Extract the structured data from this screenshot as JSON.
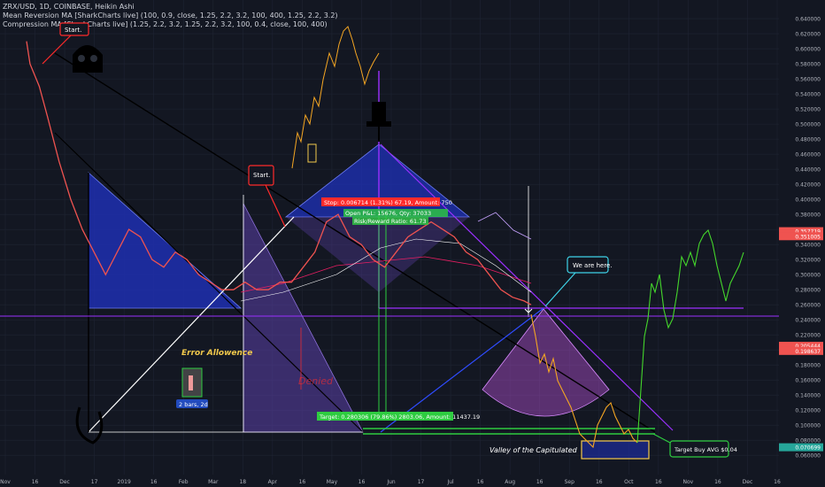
{
  "header": {
    "symbol_line": "ZRX/USD, 1D, COINBASE, Heikin Ashi",
    "indicator_1": "Mean Reversion MA [SharkCharts live] (100, 0.9, close, 1.25, 2.2, 3.2, 100, 400, 1.25, 2.2, 3.2)",
    "indicator_2": "Compression MA [SharkCharts live] (1.25, 2.2, 3.2, 1.25, 2.2, 3.2, 100, 0.4, close, 100, 400)"
  },
  "colors": {
    "background": "#131722",
    "grid": "#1f2433",
    "candle_up": "#26a69a",
    "candle_down": "#ef5350",
    "triangle_blue": "#1e2fb0",
    "triangle_purple": "#5b3fa8",
    "projection_orange": "#f5a623",
    "projection_green": "#44d62c",
    "support_purple": "#9b30ff",
    "annotation_red": "#ff2b2b",
    "annotation_cyan": "#3ed3e8",
    "annotation_green": "#2ecc40",
    "label_yellow": "#f2c94c"
  },
  "chart_data": {
    "type": "line",
    "title": "ZRX/USD, 1D, COINBASE, Heikin Ashi",
    "x_tick_labels": [
      "Nov",
      "16",
      "Dec",
      "17",
      "2019",
      "16",
      "Feb",
      "Mar",
      "18",
      "Apr",
      "16",
      "May",
      "16",
      "Jun",
      "17",
      "Jul",
      "16",
      "Aug",
      "16",
      "Sep",
      "16",
      "Oct",
      "16",
      "Nov",
      "16",
      "Dec",
      "16"
    ],
    "y_tick_labels": [
      "0.640000",
      "0.620000",
      "0.600000",
      "0.580000",
      "0.560000",
      "0.540000",
      "0.520000",
      "0.500000",
      "0.480000",
      "0.460000",
      "0.440000",
      "0.420000",
      "0.400000",
      "0.380000",
      "0.360000",
      "0.340000",
      "0.320000",
      "0.300000",
      "0.280000",
      "0.260000",
      "0.240000",
      "0.220000",
      "0.200000",
      "0.180000",
      "0.160000",
      "0.140000",
      "0.120000",
      "0.100000",
      "0.080000",
      "0.060000"
    ],
    "ylim": [
      0.052,
      0.646
    ],
    "price_badges": [
      {
        "value": "0.357719",
        "color": "#ef5350"
      },
      {
        "value": "0.351005",
        "color": "#ef5350"
      },
      {
        "value": "0.205444",
        "color": "#ef5350"
      },
      {
        "value": "0.198637",
        "color": "#ef5350"
      },
      {
        "value": "0.070699",
        "color": "#26a69a"
      }
    ],
    "series": [
      {
        "name": "",
        "color": "mixed",
        "points": [
          [
            0.614,
            0.61
          ],
          [
            0.617,
            0.58
          ],
          [
            0.625,
            0.55
          ],
          [
            0.632,
            0.51
          ],
          [
            0.642,
            0.45
          ],
          [
            0.652,
            0.4
          ],
          [
            0.662,
            0.36
          ],
          [
            0.672,
            0.33
          ],
          [
            0.682,
            0.3
          ],
          [
            0.692,
            0.33
          ],
          [
            0.702,
            0.36
          ],
          [
            0.712,
            0.35
          ],
          [
            0.722,
            0.32
          ],
          [
            0.732,
            0.31
          ],
          [
            0.742,
            0.33
          ],
          [
            0.752,
            0.32
          ],
          [
            0.762,
            0.3
          ],
          [
            0.772,
            0.29
          ],
          [
            0.782,
            0.28
          ],
          [
            0.792,
            0.28
          ],
          [
            0.802,
            0.29
          ],
          [
            0.812,
            0.28
          ],
          [
            0.822,
            0.28
          ],
          [
            0.832,
            0.29
          ],
          [
            0.842,
            0.29
          ],
          [
            0.852,
            0.31
          ],
          [
            0.862,
            0.33
          ],
          [
            0.872,
            0.37
          ],
          [
            0.882,
            0.38
          ],
          [
            0.892,
            0.35
          ],
          [
            0.902,
            0.34
          ],
          [
            0.912,
            0.32
          ],
          [
            0.922,
            0.31
          ],
          [
            0.932,
            0.33
          ],
          [
            0.942,
            0.35
          ],
          [
            0.952,
            0.36
          ],
          [
            0.962,
            0.37
          ],
          [
            0.972,
            0.36
          ],
          [
            0.982,
            0.35
          ],
          [
            0.992,
            0.33
          ],
          [
            1.002,
            0.32
          ],
          [
            1.012,
            0.3
          ],
          [
            1.022,
            0.28
          ],
          [
            1.032,
            0.27
          ],
          [
            1.042,
            0.265
          ],
          [
            1.048,
            0.26
          ]
        ]
      }
    ]
  },
  "annotations": {
    "start_top": "Start.",
    "start_mid": "Start.",
    "we_are_here": "We are here.",
    "error_allowance": "Error Allowence",
    "denied": "Denied",
    "bars_label": "2 bars, 2d",
    "target_bar": "Target: 0.280306 (79.86%) 2803.06, Amount: 11437.19",
    "stop_bar": "Stop: 0.006714 (1.31%) 67.19, Amount: 750",
    "open_bar": "Open P&L: 15676, Qty: 37033",
    "risk_reward": "Risk/Reward Ratio: 61.73",
    "valley": "Valley of the Capitulated",
    "target_buy": "Target Buy AVG $0.04"
  }
}
